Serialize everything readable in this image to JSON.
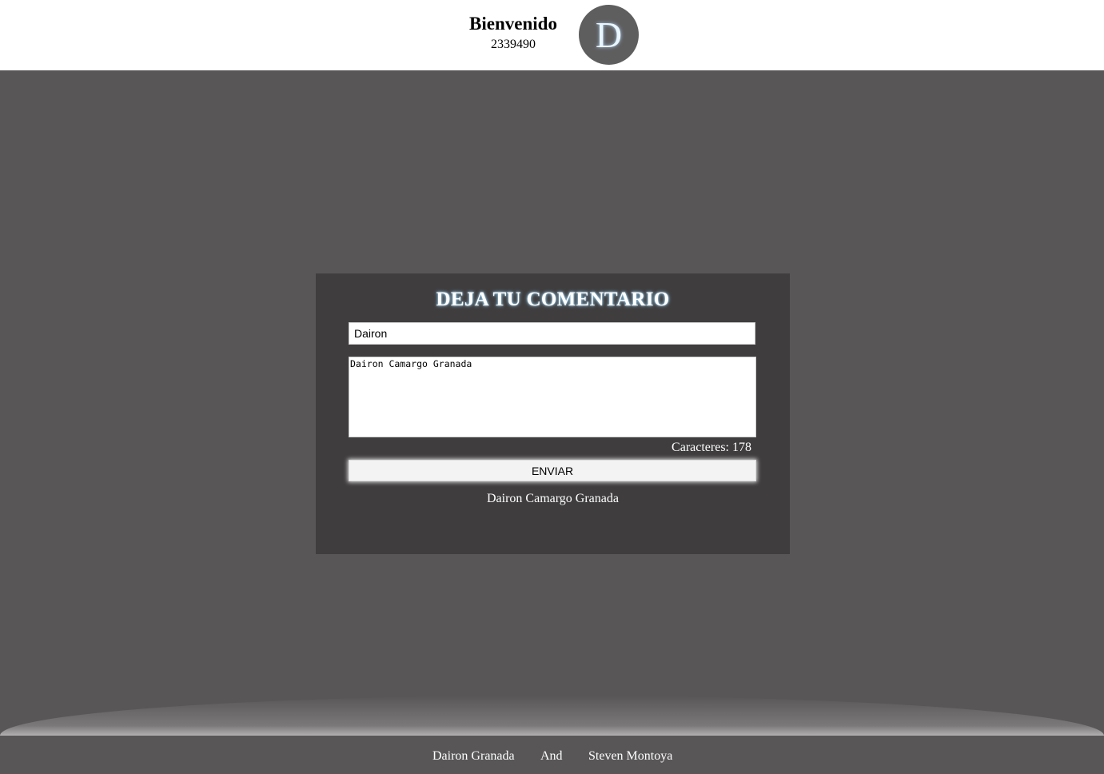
{
  "header": {
    "welcome_title": "Bienvenido",
    "user_id": "2339490",
    "avatar_letter": "D"
  },
  "comment_form": {
    "title": "DEJA TU COMENTARIO",
    "name_value": "Dairon",
    "comment_value": "Dairon Camargo Granada",
    "char_count": "Caracteres: 178",
    "send_label": "ENVIAR",
    "result_text": "Dairon Camargo Granada"
  },
  "footer": {
    "author_1": "Dairon Granada",
    "separator": "And",
    "author_2": "Steven Montoya"
  }
}
